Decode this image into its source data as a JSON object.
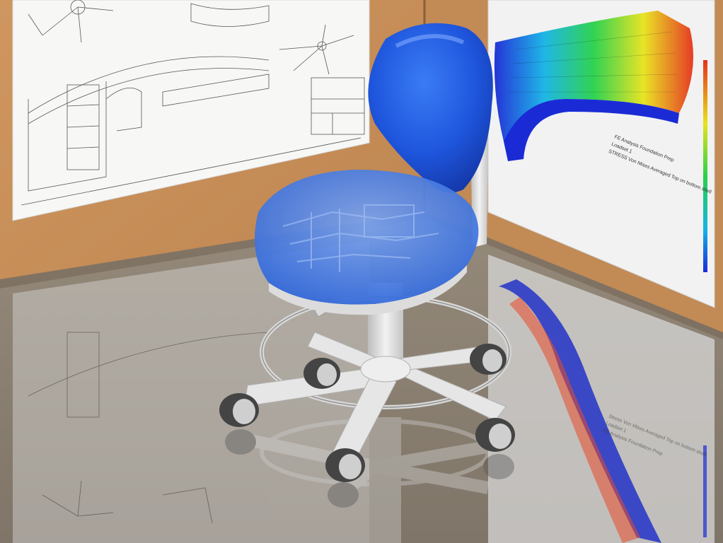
{
  "scene": {
    "subject": "medical stool with blue backrest and translucent blue seat showing internal structure",
    "colors": {
      "wall_wood": "#c98f57",
      "wall_shadow": "#a36f3f",
      "floor_reflection": "#8d8272",
      "chair_blue": "#1f5be0",
      "chair_base": "#e4e4e4",
      "caster_dark": "#333333"
    }
  },
  "fea_panel": {
    "line1": "FE Analysis Foundation Prep",
    "line2": "Loadset 1",
    "line3": "STRESS Von Mises Averaged Top on bottom shell"
  },
  "reflection_panel": {
    "line1": "Stress Von Mises Averaged Top on bottom shell",
    "line2": "Loadset 1",
    "line3": "FE Analysis Foundation Prep"
  }
}
